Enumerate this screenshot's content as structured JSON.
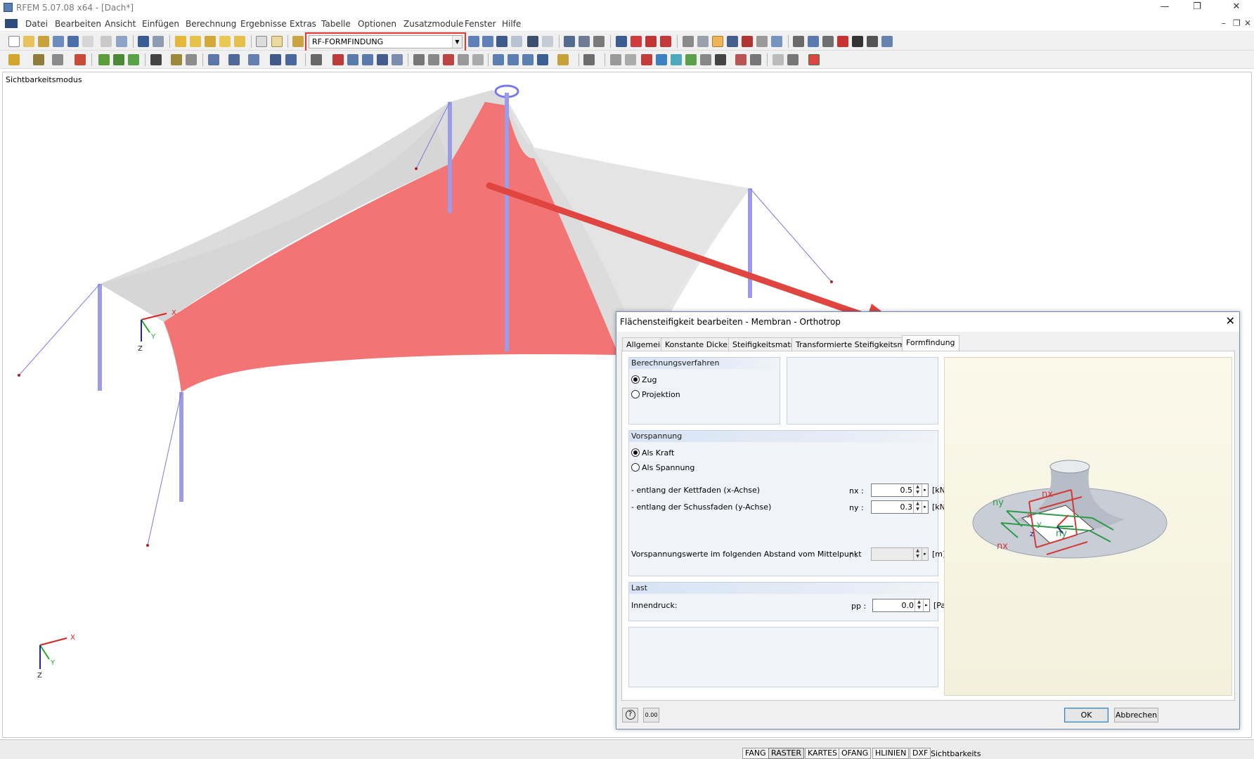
{
  "window": {
    "title": "RFEM 5.07.08 x64 - [Dach*]",
    "minimize": "—",
    "restore": "❐",
    "close": "✕"
  },
  "menu": {
    "items": [
      "Datei",
      "Bearbeiten",
      "Ansicht",
      "Einfügen",
      "Berechnung",
      "Ergebnisse",
      "Extras",
      "Tabelle",
      "Optionen",
      "Zusatzmodule",
      "Fenster",
      "Hilfe"
    ],
    "doc_min": "–",
    "doc_restore": "❐",
    "doc_close": "✕"
  },
  "toolbar": {
    "loadcase_combo": "RF-FORMFINDUNG"
  },
  "viewport": {
    "mode_label": "Sichtbarkeitsmodus",
    "axis_x": "X",
    "axis_y": "Y",
    "axis_z": "Z"
  },
  "dialog": {
    "title": "Flächensteifigkeit bearbeiten - Membran - Orthotrop",
    "close": "✕",
    "tabs": [
      "Allgemein",
      "Konstante Dicke",
      "Steifigkeitsmatrix",
      "Transformierte Steifigkeitsmatrix",
      "Formfindung"
    ],
    "active_tab": "Formfindung",
    "berechnung": {
      "header": "Berechnungsverfahren",
      "options": [
        "Zug",
        "Projektion"
      ],
      "selected": "Zug"
    },
    "vorspannung": {
      "header": "Vorspannung",
      "options": [
        "Als Kraft",
        "Als Spannung"
      ],
      "selected": "Als Kraft",
      "kett_label": "- entlang der Kettfaden (x-Achse)",
      "kett_sym": "nx :",
      "kett_value": "0.5",
      "kett_unit": "[kN/m]",
      "schuss_label": "- entlang der Schussfaden (y-Achse)",
      "schuss_sym": "ny :",
      "schuss_value": "0.3",
      "schuss_unit": "[kN/m]",
      "abstand_label": "Vorspannungswerte im folgenden Abstand vom Mittelpunkt",
      "abstand_sym": "r :",
      "abstand_value": "",
      "abstand_unit": "[m]"
    },
    "last": {
      "header": "Last",
      "label": "Innendruck:",
      "sym": "pp :",
      "value": "0.0",
      "unit": "[Pa]"
    },
    "preview_labels": {
      "nx_top": "nx",
      "nx_bottom": "nx",
      "ny_left": "ny",
      "ny_right": "ny",
      "x": "x",
      "y": "y",
      "z": "z"
    },
    "ok": "OK",
    "cancel": "Abbrechen",
    "units_icon_text": "0.00"
  },
  "status": {
    "items": [
      "FANG",
      "RASTER",
      "KARTES",
      "OFANG",
      "HLINIEN",
      "DXF"
    ],
    "pressed": "RASTER",
    "text": "Sichtbarkeits"
  },
  "colors": {
    "membrane_red": "#f27474",
    "membrane_gray": "#c8c8c8",
    "column_blue": "#9b9be8",
    "arrow_red": "#e0453f"
  }
}
